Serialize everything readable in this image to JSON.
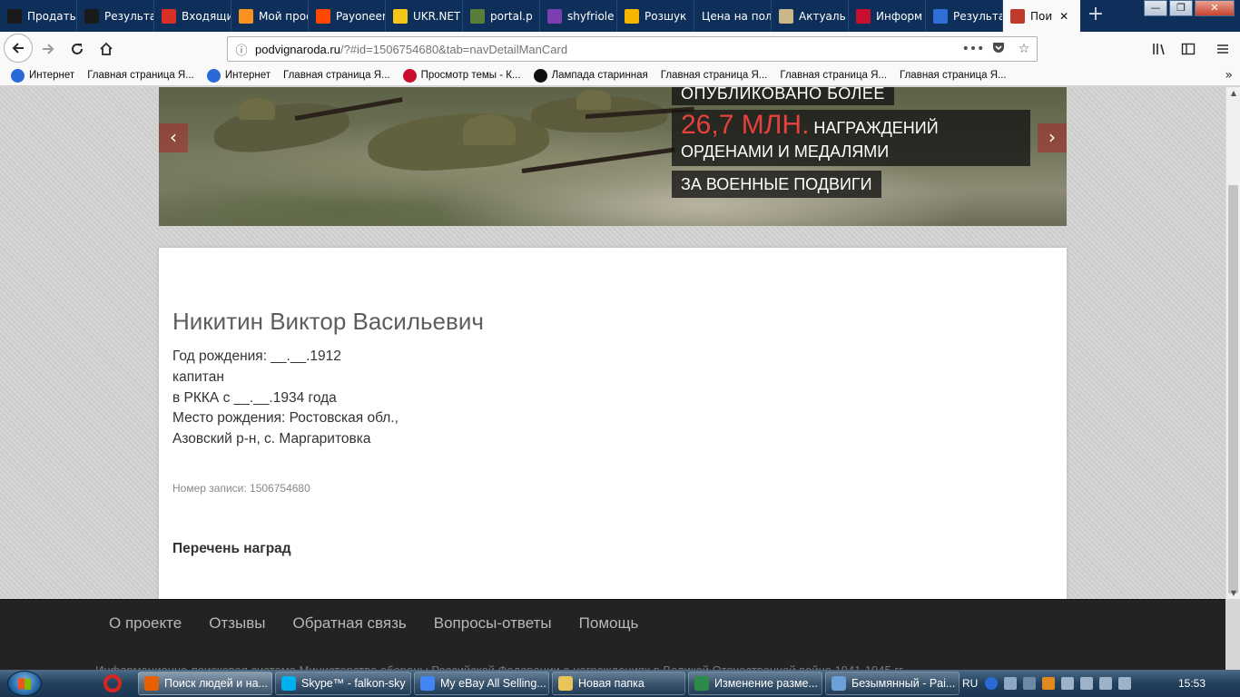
{
  "browser": {
    "tabs": [
      {
        "title": "Продать вещи",
        "icon": "crown-icon",
        "color": "#1a1a1a"
      },
      {
        "title": "Результаты",
        "icon": "crown-icon",
        "color": "#1a1a1a"
      },
      {
        "title": "Входящие",
        "icon": "gmail-icon",
        "color": "#d93025"
      },
      {
        "title": "Мой профиль",
        "icon": "ok-icon",
        "color": "#f7931e"
      },
      {
        "title": "Payoneer",
        "icon": "payoneer-icon",
        "color": "#ff4800"
      },
      {
        "title": "UKR.NET",
        "icon": "ukrnet-icon",
        "color": "#f5c518"
      },
      {
        "title": "portal.p",
        "icon": "gear-icon",
        "color": "#5a7d3a"
      },
      {
        "title": "shyfriole",
        "icon": "color-bars-icon",
        "color": "#7a3fb0"
      },
      {
        "title": "Розшук",
        "icon": "map-pin-icon",
        "color": "#f4b400"
      },
      {
        "title": "Цена на пол",
        "icon": "",
        "color": "#0d2f5a"
      },
      {
        "title": "Актуаль",
        "icon": "photo-icon",
        "color": "#c9b88a"
      },
      {
        "title": "Информ",
        "icon": "a-logo-icon",
        "color": "#c8102e"
      },
      {
        "title": "Результа",
        "icon": "snowflake-icon",
        "color": "#2f6fd6"
      },
      {
        "title": "Пои",
        "icon": "star-badge-icon",
        "color": "#c0392b"
      }
    ],
    "window_controls": {
      "minimize": "—",
      "restore": "❐",
      "close": "✕"
    },
    "url_host": "podvignaroda.ru",
    "url_rest": "/?#id=1506754680&tab=navDetailManCard",
    "bookmarks": [
      {
        "label": "Интернет",
        "color": "#2a6ad8"
      },
      {
        "label": "Главная страница Я...",
        "color": ""
      },
      {
        "label": "Интернет",
        "color": "#2a6ad8"
      },
      {
        "label": "Главная страница Я...",
        "color": ""
      },
      {
        "label": "Просмотр темы - К...",
        "color": "#c8102e"
      },
      {
        "label": "Лампада старинная",
        "color": "#111111"
      },
      {
        "label": "Главная страница Я...",
        "color": ""
      },
      {
        "label": "Главная страница Я...",
        "color": ""
      },
      {
        "label": "Главная страница Я...",
        "color": ""
      }
    ]
  },
  "banner": {
    "line1": "ОПУБЛИКОВАНО БОЛЕЕ",
    "big": "26,7 МЛН.",
    "line2_rest": "НАГРАЖДЕНИЙ",
    "line2b": "ОРДЕНАМИ И МЕДАЛЯМИ",
    "line3": "ЗА ВОЕННЫЕ ПОДВИГИ",
    "prev": "‹",
    "next": "›",
    "accent_color": "#e8413b"
  },
  "person": {
    "name": "Никитин Виктор Васильевич",
    "birth_year": "Год рождения: __.__.1912",
    "rank": "капитан",
    "service": "в РККА с __.__.1934 года",
    "birthplace_1": "Место рождения: Ростовская обл.,",
    "birthplace_2": "Азовский р-н, с. Маргаритовка",
    "record": "Номер записи: 1506754680",
    "awards_heading": "Перечень наград"
  },
  "footer": {
    "links": [
      "О проекте",
      "Отзывы",
      "Обратная связь",
      "Вопросы-ответы",
      "Помощь"
    ],
    "text": "Информационно-поисковая система Министерства обороны Российской Федерации о награждениях в Великой Отечественной войне 1941-1945 гг."
  },
  "taskbar": {
    "items": [
      {
        "label": "Поиск людей и на...",
        "color": "#e66000",
        "active": true
      },
      {
        "label": "Skype™ - falkon-sky",
        "color": "#00aff0",
        "active": false
      },
      {
        "label": "My eBay All Selling...",
        "color": "#4285f4",
        "active": false
      },
      {
        "label": "Новая папка",
        "color": "#e8c45a",
        "active": false
      },
      {
        "label": "Изменение разме...",
        "color": "#2c8a4a",
        "active": false
      },
      {
        "label": "Безымянный - Pai...",
        "color": "#6aa2d8",
        "active": false
      }
    ],
    "lang": "RU",
    "clock": "15:53"
  }
}
